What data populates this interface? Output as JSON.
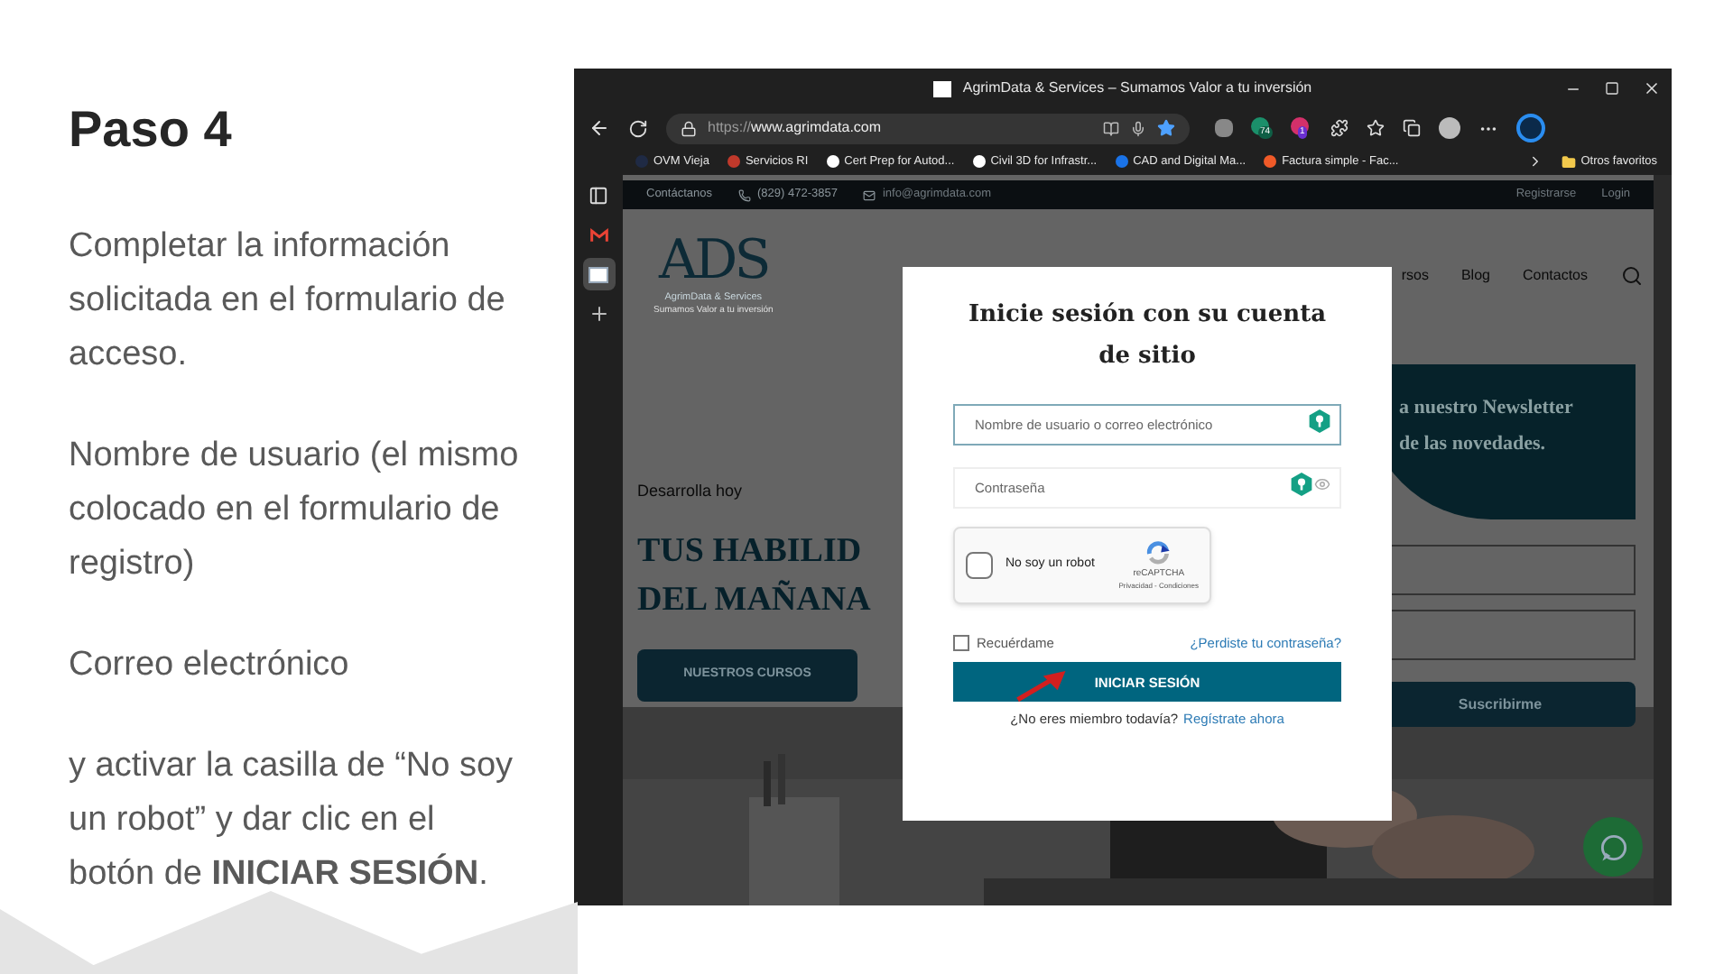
{
  "slide": {
    "title": "Paso 4",
    "paragraphs": [
      "Completar la información solicitada en el formulario de acceso.",
      "Nombre de usuario (el mismo colocado en el formulario de registro)",
      "Correo electrónico",
      "y activar la casilla de “No soy un robot” y dar clic en el botón de **INICIAR SESIÓN**."
    ]
  },
  "browser": {
    "title": "AgrimData & Services – Sumamos Valor a tu inversión",
    "url_scheme": "https://",
    "url_host": "www.agrimdata.com",
    "favorited": true,
    "extension_badges": [
      "74",
      "1"
    ],
    "bookmarks": [
      {
        "label": "OVM Vieja",
        "color": "#1f2a44"
      },
      {
        "label": "Servicios RI",
        "color": "#c0392b"
      },
      {
        "label": "Cert Prep for Autod...",
        "color": "#ffffff"
      },
      {
        "label": "Civil 3D for Infrastr...",
        "color": "#ffffff"
      },
      {
        "label": "CAD and Digital Ma...",
        "color": "#1a73e8"
      },
      {
        "label": "Factura simple - Fac...",
        "color": "#f05a28"
      }
    ],
    "other_favorites": "Otros favoritos",
    "sidebar": [
      {
        "kind": "tabs",
        "selected": false
      },
      {
        "kind": "mail",
        "selected": false
      },
      {
        "kind": "site",
        "selected": true
      },
      {
        "kind": "add",
        "selected": false
      }
    ]
  },
  "site": {
    "contact": "Contáctanos",
    "phone": "(829) 472-3857",
    "email": "info@agrimdata.com",
    "register": "Registrarse",
    "login": "Login",
    "logo": {
      "mark": "ADS",
      "name": "AgrimData & Services",
      "tagline": "Sumamos Valor a tu inversión"
    },
    "nav": [
      "rsos",
      "Blog",
      "Contactos"
    ],
    "hero": {
      "kicker": "Desarrolla hoy",
      "headline": [
        "TUS HABILID",
        "DEL MAÑANA"
      ],
      "button": "NUESTROS CURSOS"
    },
    "newsletter": {
      "lines": [
        "a nuestro Newsletter",
        "de las novedades."
      ],
      "button": "Suscribirme"
    }
  },
  "modal": {
    "title": "Inicie sesión con su cuenta de sitio",
    "username": {
      "placeholder": "Nombre de usuario o correo electrónico",
      "focused": true
    },
    "password": {
      "placeholder": "Contraseña",
      "focused": false
    },
    "captcha": {
      "label": "No soy un robot",
      "checked": false,
      "brand": "reCAPTCHA",
      "links": "Privacidad - Condiciones"
    },
    "remember": {
      "label": "Recuérdame",
      "checked": false
    },
    "forgot": "¿Perdiste tu contraseña?",
    "submit": "INICIAR SESIÓN",
    "signup_prompt": "¿No eres miembro todavía?",
    "signup_link": "Regístrate ahora"
  }
}
